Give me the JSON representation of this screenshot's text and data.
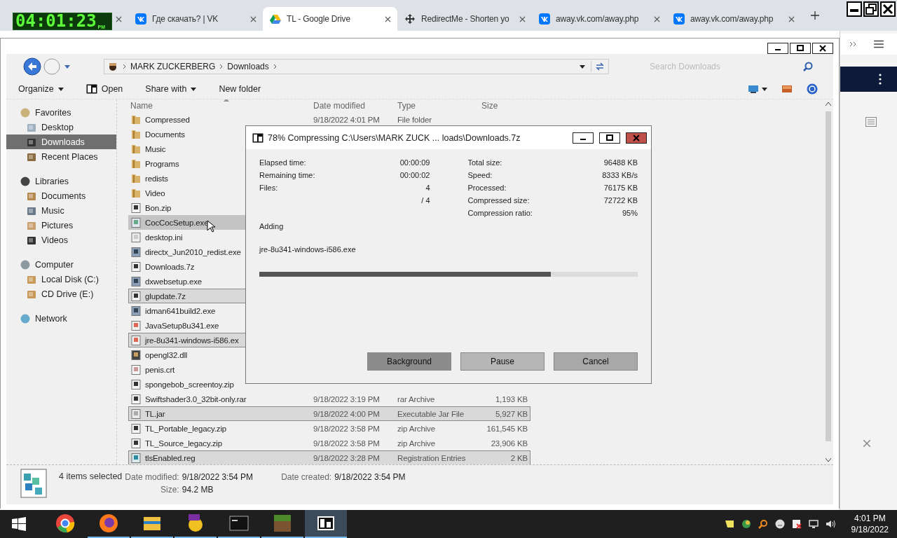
{
  "clock": {
    "time": "04:01:23",
    "suffix": "PM"
  },
  "browser_tabs": [
    {
      "kind": "vk",
      "title": "Где скачать? | VK",
      "selected": false
    },
    {
      "kind": "drive",
      "title": "TL - Google Drive",
      "selected": true
    },
    {
      "kind": "redirect",
      "title": "RedirectMe - Shorten yo",
      "selected": false
    },
    {
      "kind": "vk",
      "title": "away.vk.com/away.php",
      "selected": false
    },
    {
      "kind": "vk",
      "title": "away.vk.com/away.php",
      "selected": false
    }
  ],
  "explorer": {
    "breadcrumb": [
      "MARK ZUCKERBERG",
      "Downloads"
    ],
    "search": {
      "placeholder": "Search Downloads"
    },
    "toolbar": [
      {
        "label": "Organize",
        "dropdown": true,
        "kind": "text"
      },
      {
        "label": "Open",
        "dropdown": false,
        "kind": "archive"
      },
      {
        "label": "Share with",
        "dropdown": true,
        "kind": "text"
      },
      {
        "label": "New folder",
        "dropdown": false,
        "kind": "text"
      }
    ],
    "nav": [
      {
        "label": "Favorites",
        "kind": "star",
        "selected": false,
        "children": [
          {
            "label": "Desktop",
            "kind": "desktop",
            "selected": false
          },
          {
            "label": "Downloads",
            "kind": "downloads",
            "selected": true
          },
          {
            "label": "Recent Places",
            "kind": "recent",
            "selected": false
          }
        ]
      },
      {
        "label": "Libraries",
        "kind": "libraries",
        "selected": false,
        "children": [
          {
            "label": "Documents",
            "kind": "docs",
            "selected": false
          },
          {
            "label": "Music",
            "kind": "music",
            "selected": false
          },
          {
            "label": "Pictures",
            "kind": "pictures",
            "selected": false
          },
          {
            "label": "Videos",
            "kind": "videos",
            "selected": false
          }
        ]
      },
      {
        "label": "Computer",
        "kind": "computer",
        "selected": false,
        "children": [
          {
            "label": "Local Disk (C:)",
            "kind": "disk",
            "selected": false
          },
          {
            "label": "CD Drive (E:)",
            "kind": "disk",
            "selected": false
          }
        ]
      },
      {
        "label": "Network",
        "kind": "network",
        "selected": false
      }
    ],
    "columns": [
      "Name",
      "Date modified",
      "Type",
      "Size"
    ],
    "rows": [
      {
        "name": "Compressed",
        "kind": "folder",
        "date": "9/18/2022 4:01 PM",
        "type": "File folder",
        "selected": false,
        "hovered": false
      },
      {
        "name": "Documents",
        "kind": "folder",
        "selected": false,
        "hovered": false
      },
      {
        "name": "Music",
        "kind": "folder",
        "selected": false,
        "hovered": false
      },
      {
        "name": "Programs",
        "kind": "folder",
        "selected": false,
        "hovered": false
      },
      {
        "name": "redists",
        "kind": "folder",
        "selected": false,
        "hovered": false
      },
      {
        "name": "Video",
        "kind": "folder",
        "selected": false,
        "hovered": false
      },
      {
        "name": "Bon.zip",
        "kind": "zip",
        "selected": false,
        "hovered": false
      },
      {
        "name": "CocCocSetup.exe",
        "kind": "setup",
        "selected": false,
        "hovered": true
      },
      {
        "name": "desktop.ini",
        "kind": "ini",
        "selected": false,
        "hovered": false
      },
      {
        "name": "directx_Jun2010_redist.exe",
        "kind": "exe",
        "selected": false,
        "hovered": false
      },
      {
        "name": "Downloads.7z",
        "kind": "sevenz",
        "selected": false,
        "hovered": false
      },
      {
        "name": "dxwebsetup.exe",
        "kind": "exe",
        "selected": false,
        "hovered": false
      },
      {
        "name": "glupdate.7z",
        "kind": "sevenz",
        "selected": true,
        "hovered": false
      },
      {
        "name": "idman641build2.exe",
        "kind": "exe",
        "selected": false,
        "hovered": false
      },
      {
        "name": "JavaSetup8u341.exe",
        "kind": "java",
        "selected": false,
        "hovered": false
      },
      {
        "name": "jre-8u341-windows-i586.ex",
        "kind": "java",
        "selected": true,
        "hovered": false
      },
      {
        "name": "opengl32.dll",
        "kind": "dll",
        "selected": false,
        "hovered": false
      },
      {
        "name": "penis.crt",
        "kind": "crt",
        "selected": false,
        "hovered": false
      },
      {
        "name": "spongebob_screentoy.zip",
        "kind": "zip",
        "selected": false,
        "hovered": false
      },
      {
        "name": "Swiftshader3.0_32bit-only.rar",
        "kind": "rar",
        "date": "9/18/2022 3:19 PM",
        "type": "rar Archive",
        "size": "1,193 KB",
        "selected": false,
        "hovered": false
      },
      {
        "name": "TL.jar",
        "kind": "jar",
        "date": "9/18/2022 4:00 PM",
        "type": "Executable Jar File",
        "size": "5,927 KB",
        "selected": true,
        "hovered": false
      },
      {
        "name": "TL_Portable_legacy.zip",
        "kind": "zip",
        "date": "9/18/2022 3:58 PM",
        "type": "zip Archive",
        "size": "161,545 KB",
        "selected": false,
        "hovered": false
      },
      {
        "name": "TL_Source_legacy.zip",
        "kind": "zip",
        "date": "9/18/2022 3:58 PM",
        "type": "zip Archive",
        "size": "23,906 KB",
        "selected": false,
        "hovered": false
      },
      {
        "name": "tlsEnabled.reg",
        "kind": "reg",
        "date": "9/18/2022 3:28 PM",
        "type": "Registration Entries",
        "size": "2 KB",
        "selected": true,
        "hovered": false
      }
    ],
    "status": {
      "count": "4 items selected",
      "fields": [
        {
          "label": "Date modified:",
          "value": "9/18/2022 3:54 PM"
        },
        {
          "label": "Date created:",
          "value": "9/18/2022 3:54 PM"
        },
        {
          "label": "Size:",
          "value": "94.2 MB"
        }
      ]
    }
  },
  "dialog": {
    "title": "78% Compressing C:\\Users\\MARK ZUCK ... loads\\Downloads.7z",
    "left_stats": [
      {
        "label": "Elapsed time:",
        "value": "00:00:09"
      },
      {
        "label": "Remaining time:",
        "value": "00:00:02"
      },
      {
        "label": "Files:",
        "value": "4"
      },
      {
        "value": "/ 4"
      }
    ],
    "right_stats": [
      {
        "label": "Total size:",
        "value": "96488 KB"
      },
      {
        "label": "Speed:",
        "value": "8333 KB/s"
      },
      {
        "label": "Processed:",
        "value": "76175 KB"
      },
      {
        "label": "Compressed size:",
        "value": "72722 KB"
      },
      {
        "label": "Compression ratio:",
        "value": "95%"
      }
    ],
    "action": "Adding",
    "current_file": "jre-8u341-windows-i586.exe",
    "progress": {
      "level": 0.77
    },
    "buttons": [
      {
        "label": "Background",
        "default": true
      },
      {
        "label": "Pause",
        "default": false
      },
      {
        "label": "Cancel",
        "default": false
      }
    ]
  },
  "taskbar": {
    "apps": [
      {
        "kind": "chrome",
        "running": false,
        "active": false
      },
      {
        "kind": "firefox",
        "running": true,
        "active": false
      },
      {
        "kind": "explorer",
        "running": true,
        "active": false
      },
      {
        "kind": "messenger",
        "running": true,
        "active": false
      },
      {
        "kind": "terminal",
        "running": true,
        "active": false
      },
      {
        "kind": "block",
        "running": true,
        "active": false
      },
      {
        "kind": "archiver",
        "running": true,
        "active": true
      }
    ],
    "time": "4:01 PM",
    "date": "9/18/2022"
  }
}
